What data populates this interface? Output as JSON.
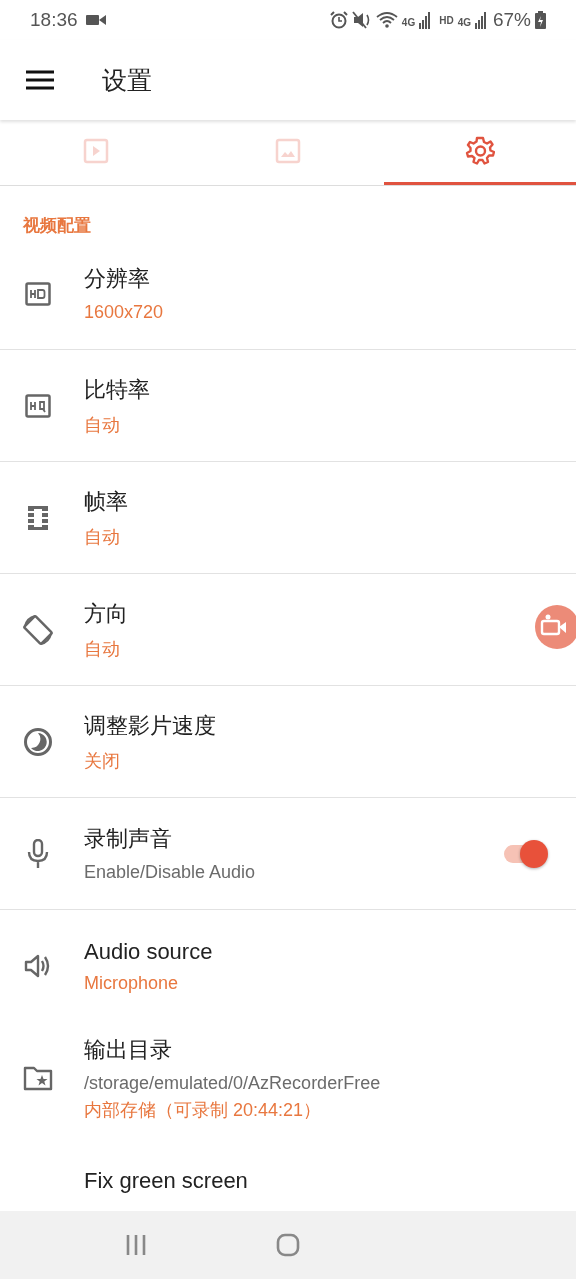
{
  "status_bar": {
    "time": "18:36",
    "network_1": "4G",
    "hd": "HD",
    "network_2": "4G",
    "battery": "67%"
  },
  "app_bar": {
    "title": "设置"
  },
  "tabs": [
    {
      "selected": false
    },
    {
      "selected": false
    },
    {
      "selected": true
    }
  ],
  "section": {
    "title": "视频配置"
  },
  "items": [
    {
      "kind": "value",
      "title": "分辨率",
      "lines": [
        {
          "kind": "value",
          "text": "1600x720"
        }
      ],
      "divider": true
    },
    {
      "kind": "value",
      "title": "比特率",
      "lines": [
        {
          "kind": "value",
          "text": "自动"
        }
      ],
      "divider": true
    },
    {
      "kind": "value",
      "title": "帧率",
      "lines": [
        {
          "kind": "value",
          "text": "自动"
        }
      ],
      "divider": true
    },
    {
      "kind": "value",
      "title": "方向",
      "lines": [
        {
          "kind": "value",
          "text": "自动"
        }
      ],
      "divider": true
    },
    {
      "kind": "value",
      "title": "调整影片速度",
      "lines": [
        {
          "kind": "value",
          "text": "关闭"
        }
      ],
      "divider": true
    },
    {
      "kind": "switch",
      "title": "录制声音",
      "lines": [
        {
          "kind": "summary",
          "text": "Enable/Disable Audio"
        }
      ],
      "on": true,
      "divider": true
    },
    {
      "kind": "value",
      "title": "Audio source",
      "lines": [
        {
          "kind": "value",
          "text": "Microphone"
        }
      ],
      "divider": false
    },
    {
      "kind": "value",
      "title": "输出目录",
      "lines": [
        {
          "kind": "summary",
          "text": "/storage/emulated/0/AzRecorderFree"
        },
        {
          "kind": "value",
          "text": "内部存储（可录制 20:44:21）"
        }
      ],
      "divider": false
    },
    {
      "kind": "plain",
      "title": "Fix green screen",
      "divider": false
    }
  ]
}
